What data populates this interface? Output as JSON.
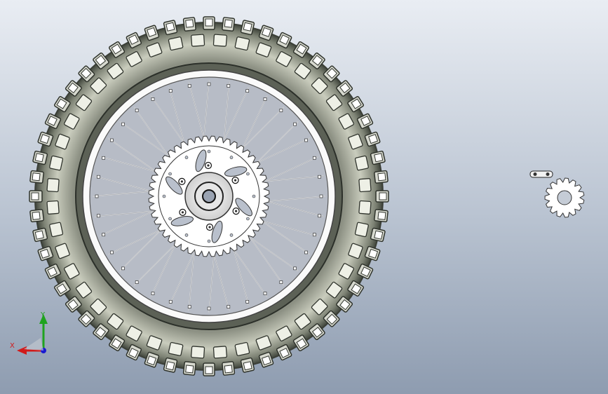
{
  "viewport": {
    "background_top": "#e9edf3",
    "background_bottom": "#8e9cb0"
  },
  "wheel": {
    "tire_color": "#6f7468",
    "knob_color": "#2f332c",
    "rim_color": "#f4f4f4",
    "spoke_color": "#e2e2e2",
    "sprocket_color": "#ffffff",
    "disc_color": "#ffffff"
  },
  "small_sprocket": {
    "color": "#ffffff"
  },
  "triad": {
    "x_label": "X",
    "y_label": "Y",
    "x_color": "#d11a1a",
    "y_color": "#1fa31f",
    "z_color": "#1a1ad1"
  }
}
